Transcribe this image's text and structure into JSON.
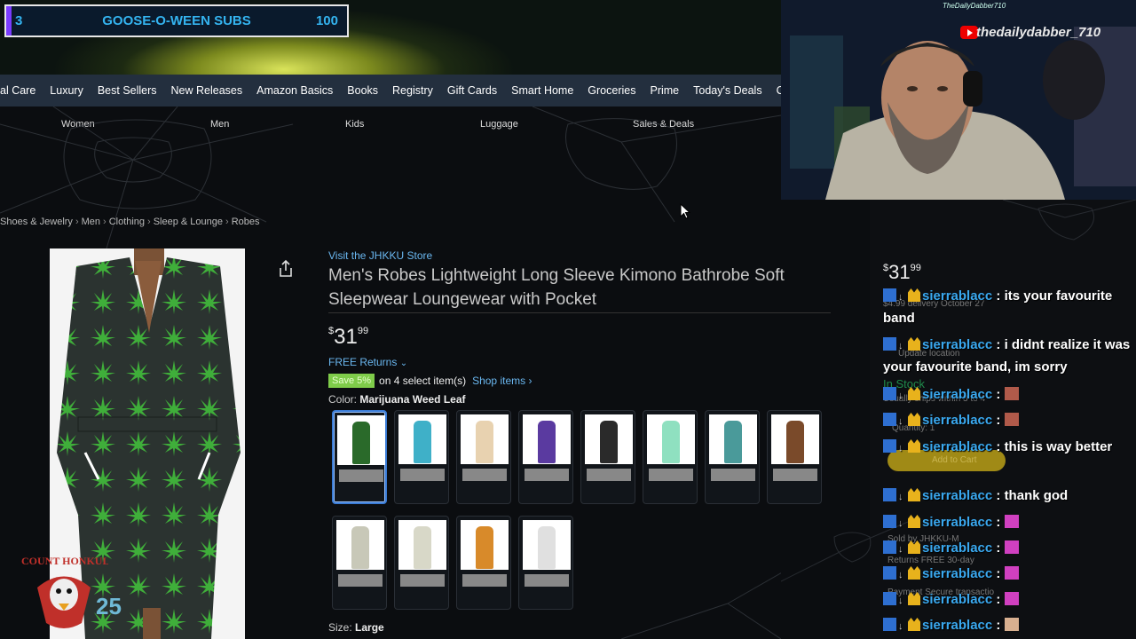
{
  "overlay": {
    "subs_left": "3",
    "subs_title": "GOOSE-O-WEEN SUBS",
    "subs_right": "100"
  },
  "nav": {
    "items": [
      "al Care",
      "Luxury",
      "Best Sellers",
      "New Releases",
      "Amazon Basics",
      "Books",
      "Registry",
      "Gift Cards",
      "Smart Home",
      "Groceries",
      "Prime",
      "Today's Deals",
      "Cu"
    ]
  },
  "subnav": {
    "items": [
      "Women",
      "Men",
      "Kids",
      "Luggage",
      "Sales & Deals"
    ]
  },
  "breadcrumb": [
    "Shoes & Jewelry",
    "Men",
    "Clothing",
    "Sleep & Lounge",
    "Robes"
  ],
  "product": {
    "store_link": "Visit the JHKKU Store",
    "title": "Men's Robes Lightweight Long Sleeve Kimono Bathrobe Soft Sleepwear Loungewear with Pocket",
    "price_symbol": "$",
    "price_whole": "31",
    "price_fraction": "99",
    "returns": "FREE Returns",
    "save_badge": "Save 5%",
    "save_text": "on 4 select item(s)",
    "shop_items": "Shop items ›",
    "color_label": "Color:",
    "color_value": "Marijuana Weed Leaf",
    "size_label": "Size:",
    "size_value": "Large",
    "swatch_colors": [
      "#2a6a2a",
      "#3fb0c8",
      "#e8d2b0",
      "#5a3aa0",
      "#2a2a2a",
      "#8fe0c0",
      "#4a9a9a",
      "#7a4a2a",
      "#c8c8b8",
      "#d8d8c8",
      "#d88a2a",
      "#e0e0e0"
    ]
  },
  "buybox": {
    "price_symbol": "$",
    "price_whole": "31",
    "price_fraction": "99",
    "delivery": "$4.99 delivery October 27",
    "update_location": "Update location",
    "in_stock": "In Stock",
    "ships": "Usually ships within 3 to 4",
    "quantity": "Quantity: 1",
    "add_to_cart": "Add to Cart",
    "sold_by": "Sold by   JHKKU-M",
    "returns": "Returns   FREE 30-day",
    "payment": "Payment   Secure transactio"
  },
  "stream": {
    "handle": "thedailydabber_710",
    "small_text": "TheDailyDabber710",
    "logo_number": "25"
  },
  "chat": [
    {
      "user": "sierrablacc",
      "message": ": its your favourite band"
    },
    {
      "user": "sierrablacc",
      "message": ": i didnt realize it was your favourite band, im sorry"
    },
    {
      "user": "sierrablacc",
      "message": ":"
    },
    {
      "user": "sierrablacc",
      "message": ":"
    },
    {
      "user": "sierrablacc",
      "message": ": this is way better"
    },
    {
      "user": "sierrablacc",
      "message": ": thank god"
    },
    {
      "user": "sierrablacc",
      "message": ":"
    },
    {
      "user": "sierrablacc",
      "message": ":"
    },
    {
      "user": "sierrablacc",
      "message": ":"
    },
    {
      "user": "sierrablacc",
      "message": ":"
    },
    {
      "user": "sierrablacc",
      "message": ":"
    }
  ],
  "colors": {
    "nav_bg": "#232f3e",
    "link": "#6ab7f0",
    "chat_user": "#3aa9f0",
    "save_badge": "#7fcc4a"
  }
}
